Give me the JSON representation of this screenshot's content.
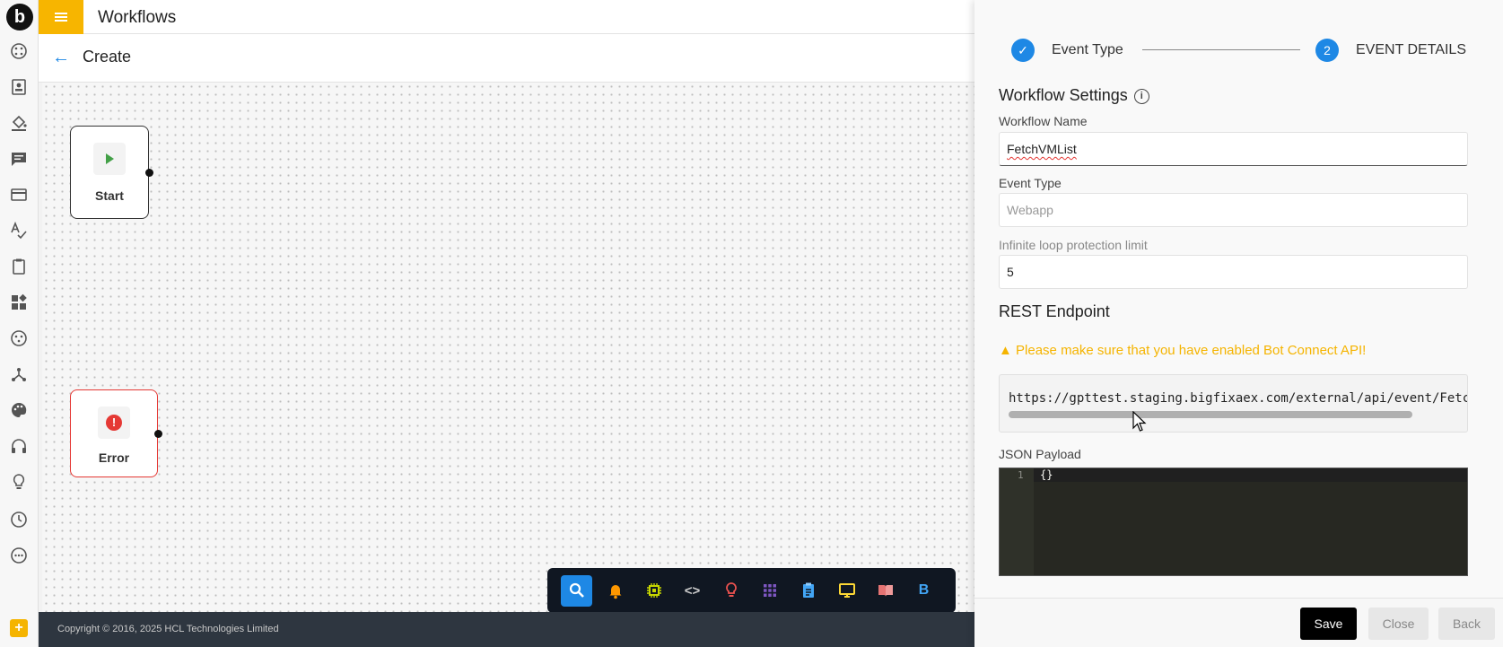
{
  "app": {
    "title": "Workflows",
    "logo_letter": "b"
  },
  "subheader": {
    "title": "Create"
  },
  "canvas": {
    "nodes": [
      {
        "id": "start",
        "label": "Start"
      },
      {
        "id": "error",
        "label": "Error",
        "icon_glyph": "!"
      }
    ]
  },
  "toolbar": {
    "items": [
      {
        "name": "search-icon",
        "active": true
      },
      {
        "name": "bell-icon"
      },
      {
        "name": "chip-icon"
      },
      {
        "name": "code-icon",
        "glyph": "<>"
      },
      {
        "name": "bulb-icon"
      },
      {
        "name": "grid-icon"
      },
      {
        "name": "clipboard-icon"
      },
      {
        "name": "monitor-icon"
      },
      {
        "name": "book-icon"
      },
      {
        "name": "b-icon",
        "glyph": "B"
      }
    ]
  },
  "footer": {
    "copyright": "Copyright © 2016, 2025 HCL Technologies Limited"
  },
  "panel": {
    "steps": [
      {
        "label": "Event Type",
        "state": "done",
        "glyph": "✓"
      },
      {
        "label": "EVENT DETAILS",
        "state": "current",
        "number": "2"
      }
    ],
    "settings_title": "Workflow Settings",
    "info_glyph": "i",
    "fields": {
      "workflow_name": {
        "label": "Workflow Name",
        "value": "FetchVMList"
      },
      "event_type": {
        "label": "Event Type",
        "value": "Webapp"
      },
      "loop_limit": {
        "label": "Infinite loop protection limit",
        "value": "5"
      }
    },
    "rest_title": "REST Endpoint",
    "warning": "Please make sure that you have enabled Bot Connect API!",
    "warning_glyph": "▲",
    "endpoint_url": "https://gpttest.staging.bigfixaex.com/external/api/event/FetchVMList",
    "json_label": "JSON Payload",
    "json_line_number": "1",
    "json_code": "{}",
    "buttons": {
      "save": "Save",
      "close": "Close",
      "back": "Back"
    }
  },
  "colors": {
    "accent": "#1e88e5",
    "brand": "#f7b500",
    "warning": "#f5b400",
    "error": "#e53935"
  }
}
